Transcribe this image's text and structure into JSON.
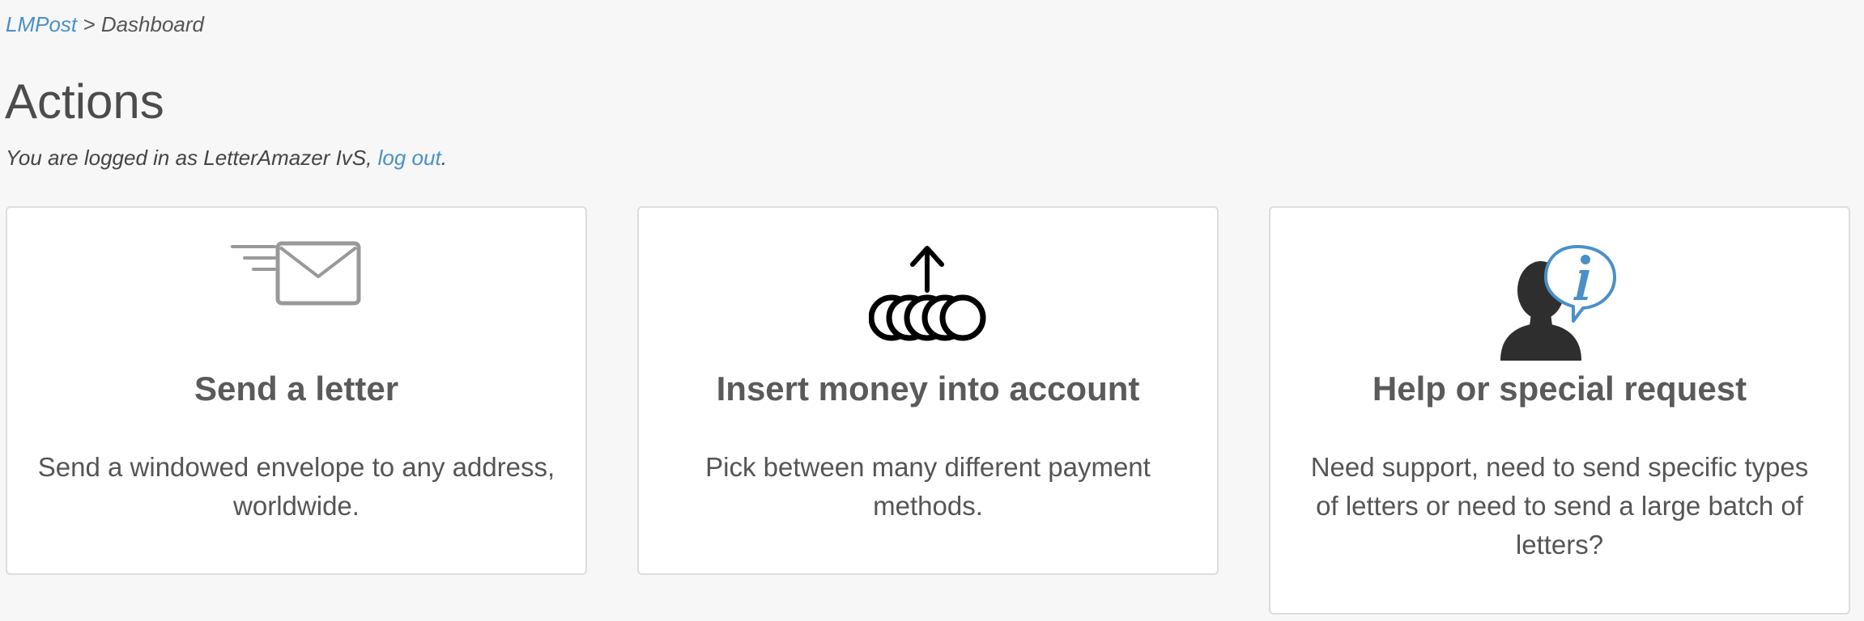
{
  "breadcrumb": {
    "home_link": "LMPost",
    "separator": ">",
    "current": "Dashboard"
  },
  "page": {
    "title": "Actions"
  },
  "login": {
    "prefix": "You are logged in as LetterAmazer IvS, ",
    "logout_link": "log out",
    "suffix": "."
  },
  "cards": [
    {
      "icon": "envelope-send-icon",
      "title": "Send a letter",
      "description": "Send a windowed envelope to any address, worldwide."
    },
    {
      "icon": "coins-insert-icon",
      "title": "Insert money into account",
      "description": "Pick between many different payment methods."
    },
    {
      "icon": "user-info-icon",
      "title": "Help or special request",
      "description": "Need support, need to send specific types of letters or need to send a large batch of letters?"
    }
  ],
  "colors": {
    "link": "#4a90c8",
    "background": "#f7f7f7",
    "card_background": "#ffffff",
    "card_border": "#dddddd",
    "info_bubble": "#4a90c8"
  }
}
